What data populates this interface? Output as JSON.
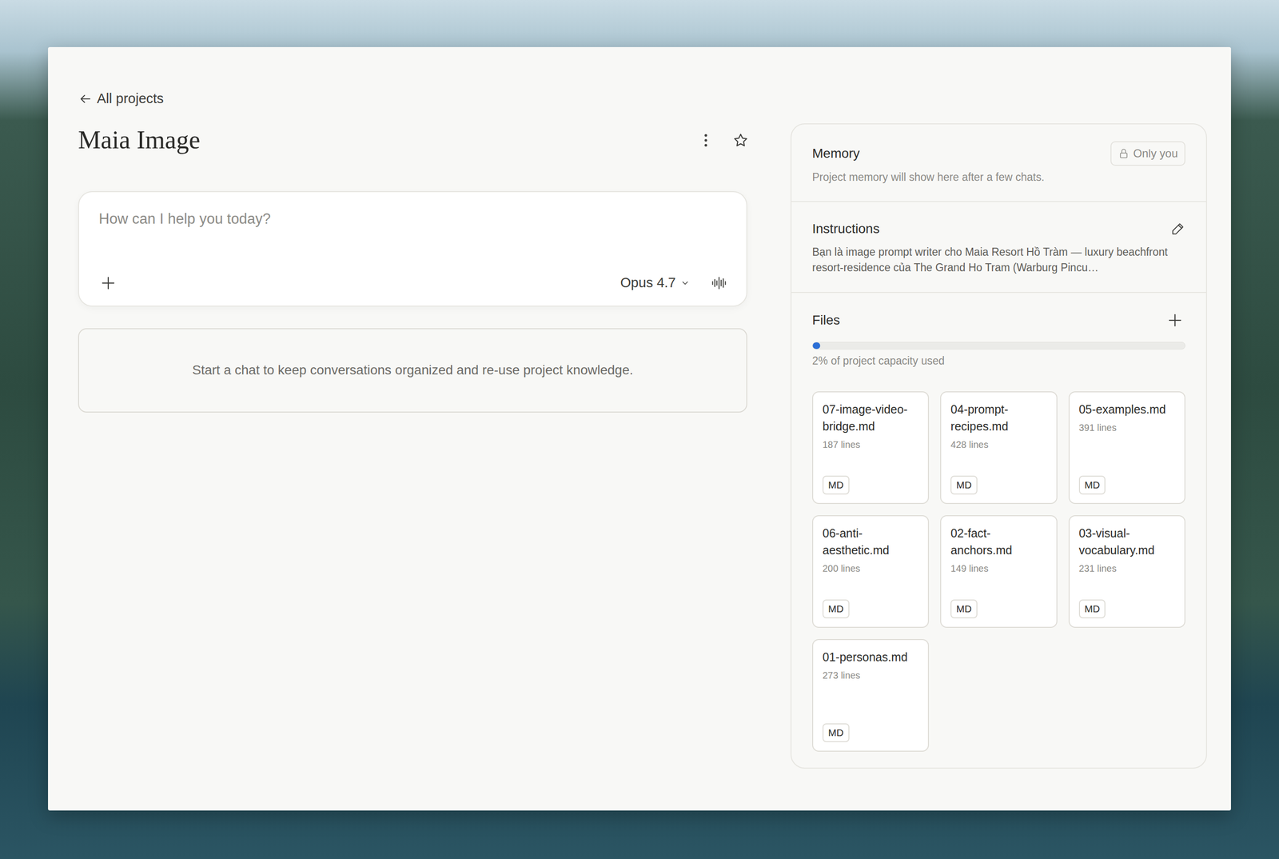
{
  "nav": {
    "back_label": "All projects"
  },
  "project": {
    "title": "Maia Image",
    "starred": false
  },
  "composer": {
    "placeholder": "How can I help you today?",
    "model": "Opus 4.7"
  },
  "empty_state": {
    "text": "Start a chat to keep conversations organized and re-use project knowledge."
  },
  "memory": {
    "title": "Memory",
    "visibility": "Only you",
    "note": "Project memory will show here after a few chats."
  },
  "instructions": {
    "title": "Instructions",
    "text": "Bạn là image prompt writer cho Maia Resort Hồ Tràm — luxury beachfront resort-residence của The Grand Ho Tram (Warburg Pincu…"
  },
  "files": {
    "title": "Files",
    "level": 0.02,
    "usage": "2% of project capacity used",
    "items": [
      {
        "name": "07-image-video-bridge.md",
        "lines": "187 lines",
        "type": "MD"
      },
      {
        "name": "04-prompt-recipes.md",
        "lines": "428 lines",
        "type": "MD"
      },
      {
        "name": "05-examples.md",
        "lines": "391 lines",
        "type": "MD"
      },
      {
        "name": "06-anti-aesthetic.md",
        "lines": "200 lines",
        "type": "MD"
      },
      {
        "name": "02-fact-anchors.md",
        "lines": "149 lines",
        "type": "MD"
      },
      {
        "name": "03-visual-vocabulary.md",
        "lines": "231 lines",
        "type": "MD"
      },
      {
        "name": "01-personas.md",
        "lines": "273 lines",
        "type": "MD"
      }
    ]
  }
}
